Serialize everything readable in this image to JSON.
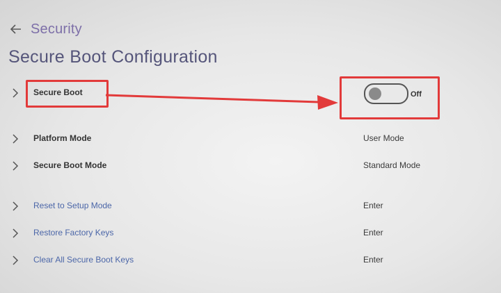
{
  "header": {
    "back_icon": "back-arrow-icon",
    "breadcrumb": "Security",
    "title": "Secure Boot Configuration"
  },
  "settings": [
    {
      "label": "Secure Boot",
      "value": "Off",
      "type": "toggle",
      "toggle_on": false
    },
    {
      "label": "Platform Mode",
      "value": "User Mode",
      "type": "info"
    },
    {
      "label": "Secure Boot Mode",
      "value": "Standard Mode",
      "type": "info"
    },
    {
      "label": "Reset to Setup Mode",
      "value": "Enter",
      "type": "action"
    },
    {
      "label": "Restore Factory Keys",
      "value": "Enter",
      "type": "action"
    },
    {
      "label": "Clear All Secure Boot Keys",
      "value": "Enter",
      "type": "action"
    }
  ],
  "colors": {
    "annotation": "#e23a3a",
    "breadcrumb": "#7d6fa8",
    "link": "#4b66a8"
  }
}
